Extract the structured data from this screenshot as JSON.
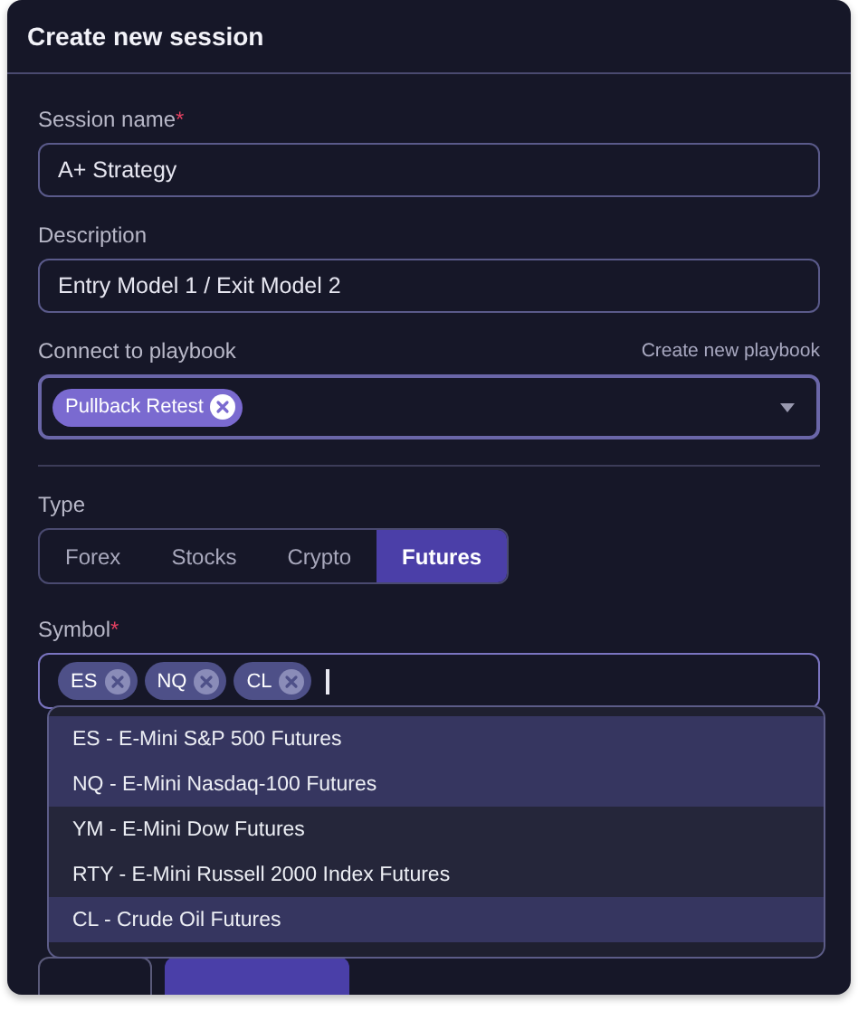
{
  "dialog": {
    "title": "Create new session"
  },
  "fields": [
    {
      "label": "Session name",
      "required_mark": "*",
      "value": "A+ Strategy"
    },
    {
      "label": "Description",
      "value": "Entry Model 1 / Exit Model 2"
    }
  ],
  "playbook": {
    "label": "Connect to playbook",
    "link": "Create new playbook",
    "chips": [
      "Pullback Retest"
    ]
  },
  "type": {
    "label": "Type",
    "options": [
      {
        "label": "Forex",
        "selected": false
      },
      {
        "label": "Stocks",
        "selected": false
      },
      {
        "label": "Crypto",
        "selected": false
      },
      {
        "label": "Futures",
        "selected": true
      }
    ]
  },
  "symbol": {
    "label": "Symbol",
    "required_mark": "*",
    "chips": [
      "ES",
      "NQ",
      "CL"
    ],
    "options": [
      {
        "label": "ES - E-Mini S&P 500 Futures",
        "selected": true
      },
      {
        "label": "NQ - E-Mini Nasdaq-100 Futures",
        "selected": true
      },
      {
        "label": "YM - E-Mini Dow Futures",
        "selected": false
      },
      {
        "label": "RTY - E-Mini Russell 2000 Index Futures",
        "selected": false
      },
      {
        "label": "CL - Crude Oil Futures",
        "selected": true
      }
    ]
  }
}
